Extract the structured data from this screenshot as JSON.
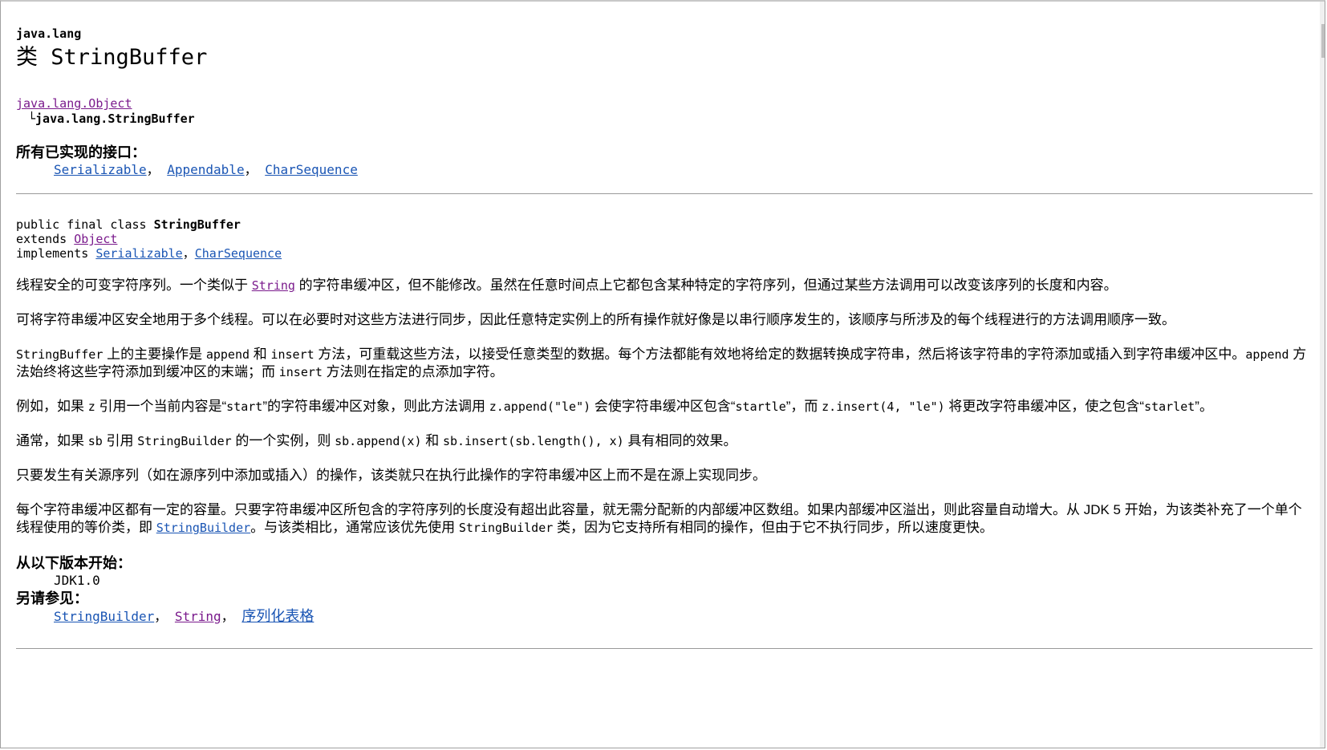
{
  "package": "java.lang",
  "class_title": "类 StringBuffer",
  "inheritance": {
    "parent": "java.lang.Object",
    "child_marker": "└",
    "child": "java.lang.StringBuffer"
  },
  "interfaces": {
    "heading": "所有已实现的接口：",
    "items": [
      "Serializable",
      "Appendable",
      "CharSequence"
    ],
    "separator": "，"
  },
  "signature": {
    "line1_prefix": "public final class ",
    "line1_name": "StringBuffer",
    "line2_prefix": "extends ",
    "line2_link": "Object",
    "line3_prefix": "implements ",
    "line3_link1": "Serializable",
    "line3_sep": "，",
    "line3_link2": "CharSequence"
  },
  "description": {
    "p1_a": "线程安全的可变字符序列。一个类似于 ",
    "p1_link": "String",
    "p1_b": " 的字符串缓冲区，但不能修改。虽然在任意时间点上它都包含某种特定的字符序列，但通过某些方法调用可以改变该序列的长度和内容。",
    "p2": "可将字符串缓冲区安全地用于多个线程。可以在必要时对这些方法进行同步，因此任意特定实例上的所有操作就好像是以串行顺序发生的，该顺序与所涉及的每个线程进行的方法调用顺序一致。",
    "p3_code1": "StringBuffer",
    "p3_a": " 上的主要操作是 ",
    "p3_code2": "append",
    "p3_b": " 和 ",
    "p3_code3": "insert",
    "p3_c": " 方法，可重载这些方法，以接受任意类型的数据。每个方法都能有效地将给定的数据转换成字符串，然后将该字符串的字符添加或插入到字符串缓冲区中。",
    "p3_code4": "append",
    "p3_d": " 方法始终将这些字符添加到缓冲区的末端；而 ",
    "p3_code5": "insert",
    "p3_e": " 方法则在指定的点添加字符。",
    "p4_a": "例如，如果 ",
    "p4_code1": "z",
    "p4_b": " 引用一个当前内容是“",
    "p4_code2": "start",
    "p4_c": "”的字符串缓冲区对象，则此方法调用 ",
    "p4_code3": "z.append(\"le\")",
    "p4_d": " 会使字符串缓冲区包含“",
    "p4_code4": "startle",
    "p4_e": "”，而 ",
    "p4_code5": "z.insert(4, \"le\")",
    "p4_f": " 将更改字符串缓冲区，使之包含“",
    "p4_code6": "starlet",
    "p4_g": "”。",
    "p5_a": "通常，如果 ",
    "p5_code1": "sb",
    "p5_b": " 引用 ",
    "p5_code2": "StringBuilder",
    "p5_c": " 的一个实例，则 ",
    "p5_code3": "sb.append(x)",
    "p5_d": " 和 ",
    "p5_code4": "sb.insert(sb.length(), x)",
    "p5_e": " 具有相同的效果。",
    "p6": "只要发生有关源序列（如在源序列中添加或插入）的操作，该类就只在执行此操作的字符串缓冲区上而不是在源上实现同步。",
    "p7_a": "每个字符串缓冲区都有一定的容量。只要字符串缓冲区所包含的字符序列的长度没有超出此容量，就无需分配新的内部缓冲区数组。如果内部缓冲区溢出，则此容量自动增大。从 JDK 5 开始，为该类补充了一个单个线程使用的等价类，即 ",
    "p7_link": "StringBuilder",
    "p7_b": "。与该类相比，通常应该优先使用 ",
    "p7_code": "StringBuilder",
    "p7_c": " 类，因为它支持所有相同的操作，但由于它不执行同步，所以速度更快。"
  },
  "since": {
    "heading": "从以下版本开始：",
    "value": "JDK1.0"
  },
  "see_also": {
    "heading": "另请参见：",
    "items": [
      "StringBuilder",
      "String",
      "序列化表格"
    ],
    "separator": "，"
  }
}
